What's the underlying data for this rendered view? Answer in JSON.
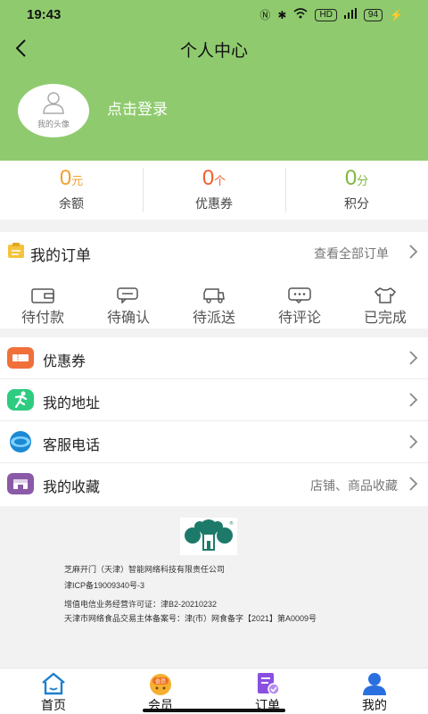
{
  "status_bar": {
    "time": "19:43",
    "signal_text": "HD",
    "battery": "94"
  },
  "header": {
    "title": "个人中心",
    "avatar_label": "我的头像",
    "login": "点击登录"
  },
  "stats": [
    {
      "value": "0",
      "unit": "元",
      "label": "余额",
      "color": "#f0a030"
    },
    {
      "value": "0",
      "unit": "个",
      "label": "优惠券",
      "color": "#f06030"
    },
    {
      "value": "0",
      "unit": "分",
      "label": "积分",
      "color": "#80b840"
    }
  ],
  "orders": {
    "title": "我的订单",
    "view_all": "查看全部订单",
    "items": [
      {
        "label": "待付款",
        "icon": "wallet-icon"
      },
      {
        "label": "待确认",
        "icon": "chat-icon"
      },
      {
        "label": "待派送",
        "icon": "truck-icon"
      },
      {
        "label": "待评论",
        "icon": "comment-icon"
      },
      {
        "label": "已完成",
        "icon": "shirt-icon"
      }
    ]
  },
  "menu": [
    {
      "label": "优惠券",
      "extra": "",
      "icon": "coupon-icon",
      "color": "#f0703a"
    },
    {
      "label": "我的地址",
      "extra": "",
      "icon": "runner-icon",
      "color": "#2ecc80"
    },
    {
      "label": "客服电话",
      "extra": "",
      "icon": "headset-icon",
      "color": "#1a8ad4"
    },
    {
      "label": "我的收藏",
      "extra": "店铺、商品收藏",
      "icon": "store-icon",
      "color": "#8a5aa8"
    }
  ],
  "footer": {
    "company": "芝麻开门（天津）智能网络科技有限责任公司",
    "icp": "津ICP备19009340号-3",
    "license": "增值电信业务经营许可证：津B2-20210232",
    "food_record": "天津市网络食品交易主体备案号：津(市）网食备字【2021】第A0009号"
  },
  "tabbar": [
    {
      "label": "首页",
      "icon": "home-icon"
    },
    {
      "label": "会员",
      "icon": "member-icon",
      "badge": "会员"
    },
    {
      "label": "订单",
      "icon": "order-icon"
    },
    {
      "label": "我的",
      "icon": "user-icon"
    }
  ],
  "colors": {
    "header_bg": "#8fcb6e",
    "accent_blue": "#2a6fe0"
  }
}
